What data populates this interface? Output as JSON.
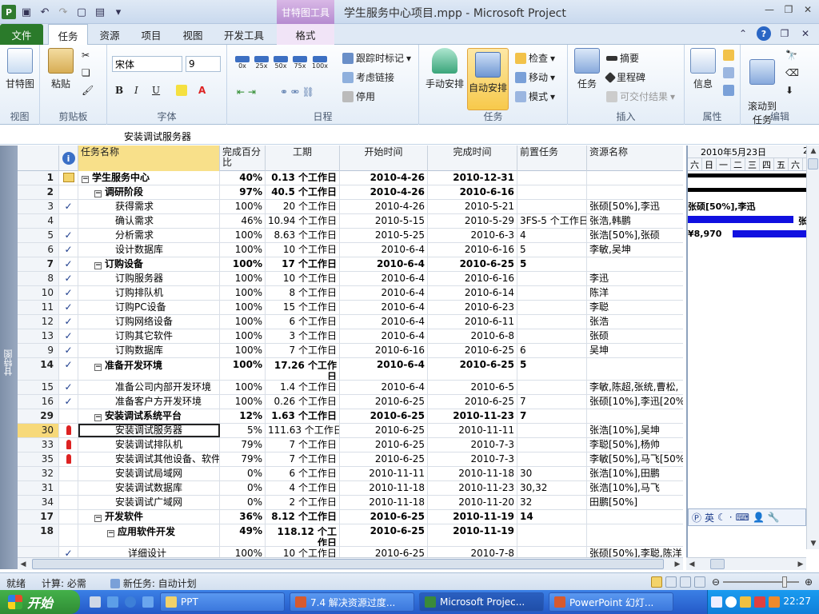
{
  "window": {
    "title": "学生服务中心项目.mpp  -  Microsoft Project",
    "context_tab_group": "甘特图工具",
    "app_icon_letter": "P"
  },
  "ribbon_tabs": [
    "文件",
    "任务",
    "资源",
    "项目",
    "视图",
    "开发工具",
    "格式"
  ],
  "ribbon": {
    "view_group": {
      "button": "甘特图",
      "label": "视图"
    },
    "clipboard_group": {
      "paste": "粘贴",
      "label": "剪贴板"
    },
    "font_group": {
      "font_name": "宋体",
      "font_size": "9",
      "bold": "B",
      "italic": "I",
      "underline": "U",
      "label": "字体"
    },
    "schedule_group": {
      "pct_buttons": [
        "0x",
        "25x",
        "50x",
        "75x",
        "100x"
      ],
      "mark_on_track": "跟踪时标记",
      "respect_links": "考虑链接",
      "inactivate": "停用",
      "label": "日程"
    },
    "tasks_group": {
      "manual": "手动安排",
      "auto": "自动安排",
      "inspect": "检查",
      "move": "移动",
      "mode": "模式",
      "label": "任务"
    },
    "insert_group": {
      "task": "任务",
      "summary": "摘要",
      "milestone": "里程碑",
      "deliverable": "可交付结果",
      "label": "插入"
    },
    "properties_group": {
      "info": "信息",
      "label": "属性"
    },
    "editing_group": {
      "scroll": "滚动到\n任务",
      "label": "编辑"
    }
  },
  "entry_bar": {
    "value": "安装调试服务器"
  },
  "view_label": "甘特图",
  "table": {
    "headers": {
      "name": "任务名称",
      "pct": "完成百分比",
      "duration": "工期",
      "start": "开始时间",
      "finish": "完成时间",
      "pred": "前置任务",
      "res": "资源名称"
    },
    "rows": [
      {
        "id": "1",
        "ind": "note",
        "level": 0,
        "summary": true,
        "name": "学生服务中心",
        "pct": "40%",
        "dur": "0.13 个工作日",
        "start": "2010-4-26",
        "finish": "2010-12-31",
        "pred": "",
        "res": ""
      },
      {
        "id": "2",
        "ind": "",
        "level": 1,
        "summary": true,
        "name": "调研阶段",
        "pct": "97%",
        "dur": "40.5 个工作日",
        "start": "2010-4-26",
        "finish": "2010-6-16",
        "pred": "",
        "res": ""
      },
      {
        "id": "3",
        "ind": "check",
        "level": 2,
        "summary": false,
        "name": "获得需求",
        "pct": "100%",
        "dur": "20 个工作日",
        "start": "2010-4-26",
        "finish": "2010-5-21",
        "pred": "",
        "res": "张硕[50%],李迅"
      },
      {
        "id": "4",
        "ind": "",
        "level": 2,
        "summary": false,
        "name": "确认需求",
        "pct": "46%",
        "dur": "10.94 个工作日",
        "start": "2010-5-15",
        "finish": "2010-5-29",
        "pred": "3FS-5 个工作日",
        "res": "张浩,韩鹏"
      },
      {
        "id": "5",
        "ind": "check",
        "level": 2,
        "summary": false,
        "name": "分析需求",
        "pct": "100%",
        "dur": "8.63 个工作日",
        "start": "2010-5-25",
        "finish": "2010-6-3",
        "pred": "4",
        "res": "张浩[50%],张硕"
      },
      {
        "id": "6",
        "ind": "check",
        "level": 2,
        "summary": false,
        "name": "设计数据库",
        "pct": "100%",
        "dur": "10 个工作日",
        "start": "2010-6-4",
        "finish": "2010-6-16",
        "pred": "5",
        "res": "李敏,吴坤"
      },
      {
        "id": "7",
        "ind": "check",
        "level": 1,
        "summary": true,
        "name": "订购设备",
        "pct": "100%",
        "dur": "17 个工作日",
        "start": "2010-6-4",
        "finish": "2010-6-25",
        "pred": "5",
        "res": ""
      },
      {
        "id": "8",
        "ind": "check",
        "level": 2,
        "summary": false,
        "name": "订购服务器",
        "pct": "100%",
        "dur": "10 个工作日",
        "start": "2010-6-4",
        "finish": "2010-6-16",
        "pred": "",
        "res": "李迅"
      },
      {
        "id": "10",
        "ind": "check",
        "level": 2,
        "summary": false,
        "name": "订购排队机",
        "pct": "100%",
        "dur": "8 个工作日",
        "start": "2010-6-4",
        "finish": "2010-6-14",
        "pred": "",
        "res": "陈洋"
      },
      {
        "id": "11",
        "ind": "check",
        "level": 2,
        "summary": false,
        "name": "订购PC设备",
        "pct": "100%",
        "dur": "15 个工作日",
        "start": "2010-6-4",
        "finish": "2010-6-23",
        "pred": "",
        "res": "李聪"
      },
      {
        "id": "12",
        "ind": "check",
        "level": 2,
        "summary": false,
        "name": "订购网络设备",
        "pct": "100%",
        "dur": "6 个工作日",
        "start": "2010-6-4",
        "finish": "2010-6-11",
        "pred": "",
        "res": "张浩"
      },
      {
        "id": "13",
        "ind": "check",
        "level": 2,
        "summary": false,
        "name": "订购其它软件",
        "pct": "100%",
        "dur": "3 个工作日",
        "start": "2010-6-4",
        "finish": "2010-6-8",
        "pred": "",
        "res": "张硕"
      },
      {
        "id": "9",
        "ind": "check",
        "level": 2,
        "summary": false,
        "name": "订购数据库",
        "pct": "100%",
        "dur": "7 个工作日",
        "start": "2010-6-16",
        "finish": "2010-6-25",
        "pred": "6",
        "res": "吴坤"
      },
      {
        "id": "14",
        "ind": "check",
        "level": 1,
        "summary": true,
        "name": "准备开发环境",
        "pct": "100%",
        "dur": "17.26 个工作日",
        "start": "2010-6-4",
        "finish": "2010-6-25",
        "pred": "5",
        "res": "",
        "tall": true
      },
      {
        "id": "15",
        "ind": "check",
        "level": 2,
        "summary": false,
        "name": "准备公司内部开发环境",
        "pct": "100%",
        "dur": "1.4 个工作日",
        "start": "2010-6-4",
        "finish": "2010-6-5",
        "pred": "",
        "res": "李敏,陈超,张统,曹松,"
      },
      {
        "id": "16",
        "ind": "check",
        "level": 2,
        "summary": false,
        "name": "准备客户方开发环境",
        "pct": "100%",
        "dur": "0.26 个工作日",
        "start": "2010-6-25",
        "finish": "2010-6-25",
        "pred": "7",
        "res": "张硕[10%],李迅[20%],"
      },
      {
        "id": "29",
        "ind": "",
        "level": 1,
        "summary": true,
        "name": "安装调试系统平台",
        "pct": "12%",
        "dur": "1.63 个工作日",
        "start": "2010-6-25",
        "finish": "2010-11-23",
        "pred": "7",
        "res": ""
      },
      {
        "id": "30",
        "ind": "person",
        "level": 2,
        "summary": false,
        "name": "安装调试服务器",
        "pct": "5%",
        "dur": "111.63 个工作日",
        "start": "2010-6-25",
        "finish": "2010-11-11",
        "pred": "",
        "res": "张浩[10%],吴坤",
        "selected": true
      },
      {
        "id": "33",
        "ind": "person",
        "level": 2,
        "summary": false,
        "name": "安装调试排队机",
        "pct": "79%",
        "dur": "7 个工作日",
        "start": "2010-6-25",
        "finish": "2010-7-3",
        "pred": "",
        "res": "李聪[50%],杨帅"
      },
      {
        "id": "35",
        "ind": "person",
        "level": 2,
        "summary": false,
        "name": "安装调试其他设备、软件",
        "pct": "79%",
        "dur": "7 个工作日",
        "start": "2010-6-25",
        "finish": "2010-7-3",
        "pred": "",
        "res": "李敏[50%],马飞[50%]"
      },
      {
        "id": "32",
        "ind": "",
        "level": 2,
        "summary": false,
        "name": "安装调试局域网",
        "pct": "0%",
        "dur": "6 个工作日",
        "start": "2010-11-11",
        "finish": "2010-11-18",
        "pred": "30",
        "res": "张浩[10%],田鹏"
      },
      {
        "id": "31",
        "ind": "",
        "level": 2,
        "summary": false,
        "name": "安装调试数据库",
        "pct": "0%",
        "dur": "4 个工作日",
        "start": "2010-11-18",
        "finish": "2010-11-23",
        "pred": "30,32",
        "res": "张浩[10%],马飞"
      },
      {
        "id": "34",
        "ind": "",
        "level": 2,
        "summary": false,
        "name": "安装调试广域网",
        "pct": "0%",
        "dur": "2 个工作日",
        "start": "2010-11-18",
        "finish": "2010-11-20",
        "pred": "32",
        "res": "田鹏[50%]"
      },
      {
        "id": "17",
        "ind": "",
        "level": 1,
        "summary": true,
        "name": "开发软件",
        "pct": "36%",
        "dur": "8.12 个工作日",
        "start": "2010-6-25",
        "finish": "2010-11-19",
        "pred": "14",
        "res": ""
      },
      {
        "id": "18",
        "ind": "",
        "level": 2,
        "summary": true,
        "name": "应用软件开发",
        "pct": "49%",
        "dur": "118.12 个工作日",
        "start": "2010-6-25",
        "finish": "2010-11-19",
        "pred": "",
        "res": "",
        "tall": true
      },
      {
        "id": "",
        "ind": "check",
        "level": 3,
        "summary": false,
        "name": "详细设计",
        "pct": "100%",
        "dur": "10 个工作日",
        "start": "2010-6-25",
        "finish": "2010-7-8",
        "pred": "",
        "res": "张硕[50%],李聪,陈洋"
      }
    ]
  },
  "gantt": {
    "week_label": "2010年5月23日",
    "next_label": "2",
    "days": [
      "六",
      "日",
      "一",
      "二",
      "三",
      "四",
      "五",
      "六"
    ],
    "label_row3": "张硕[50%],李迅",
    "label_row5": "¥8,970",
    "label_row4_tail": "张"
  },
  "ime": {
    "lang": "英"
  },
  "status": {
    "ready": "就绪",
    "calc": "计算: 必需",
    "new_tasks": "新任务: 自动计划"
  },
  "taskbar": {
    "start": "开始",
    "items": [
      "PPT",
      "7.4 解决资源过度...",
      "Microsoft Projec...",
      "PowerPoint 幻灯..."
    ],
    "clock": "22:27"
  }
}
